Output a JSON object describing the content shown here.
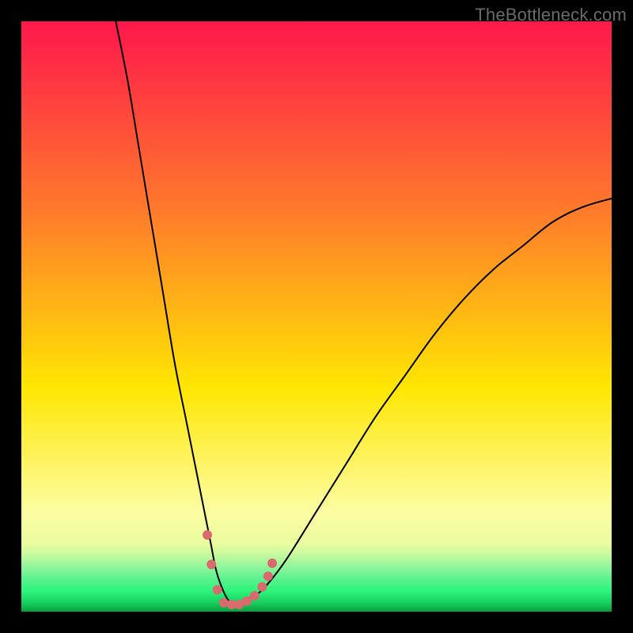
{
  "watermark": "TheBottleneck.com",
  "chart_data": {
    "type": "line",
    "title": "",
    "xlabel": "",
    "ylabel": "",
    "xlim": [
      0,
      100
    ],
    "ylim": [
      0,
      100
    ],
    "background_gradient": {
      "top": "#ff174c",
      "mid_upper": "#ff7a2b",
      "mid": "#ffe602",
      "lower": "#fdfda2",
      "bottom_band": "#2cf57a",
      "bottom_line": "#05a13c"
    },
    "series": [
      {
        "name": "bottleneck-curve",
        "color": "#000000",
        "stroke_width": 2,
        "x": [
          16,
          18,
          20,
          22,
          24,
          26,
          28,
          30,
          32,
          33,
          34,
          35,
          36,
          37,
          38,
          40,
          42,
          45,
          50,
          55,
          60,
          65,
          70,
          75,
          80,
          85,
          90,
          95,
          100
        ],
        "values": [
          100,
          90,
          78,
          66,
          54,
          42,
          32,
          22,
          12,
          7,
          4,
          2,
          1,
          1,
          2,
          3,
          5,
          9,
          17,
          25,
          33,
          40,
          47,
          53,
          58,
          62,
          66,
          68.5,
          70
        ]
      }
    ],
    "markers": {
      "name": "minimum-markers",
      "color": "#d96a6e",
      "radius": 6,
      "points": [
        {
          "x": 31.5,
          "y": 13
        },
        {
          "x": 32.2,
          "y": 8
        },
        {
          "x": 33.2,
          "y": 3.7
        },
        {
          "x": 34.3,
          "y": 1.5
        },
        {
          "x": 35.6,
          "y": 1.2
        },
        {
          "x": 36.9,
          "y": 1.2
        },
        {
          "x": 38.2,
          "y": 1.8
        },
        {
          "x": 39.5,
          "y": 2.7
        },
        {
          "x": 40.8,
          "y": 4.2
        },
        {
          "x": 41.8,
          "y": 6.0
        },
        {
          "x": 42.5,
          "y": 8.2
        }
      ]
    }
  }
}
